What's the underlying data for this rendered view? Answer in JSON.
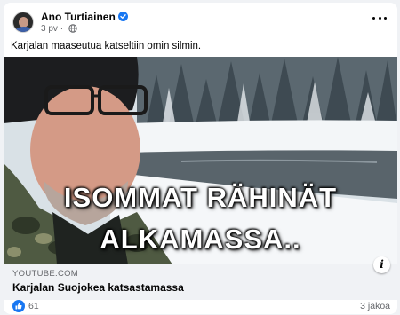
{
  "post": {
    "author": "Ano Turtiainen",
    "time": "3 pv",
    "separator": "·",
    "text": "Karjalan maaseutua katseltiin omin silmin."
  },
  "media": {
    "overlay_line1": "ISOMMAT RÄHINÄT",
    "overlay_line2": "ALKAMASSA.."
  },
  "link": {
    "domain": "YOUTUBE.COM",
    "title": "Karjalan Suojokea katsastamassa",
    "info_label": "i"
  },
  "reactions": {
    "like_count": "61",
    "shares": "3 jakoa"
  },
  "colors": {
    "facebook_blue": "#1877f2",
    "link_bar_bg": "#f0f2f5",
    "secondary_text": "#65676b"
  },
  "icons": [
    "verified-badge-icon",
    "globe-icon",
    "more-options-icon",
    "info-icon",
    "like-reaction-icon"
  ]
}
